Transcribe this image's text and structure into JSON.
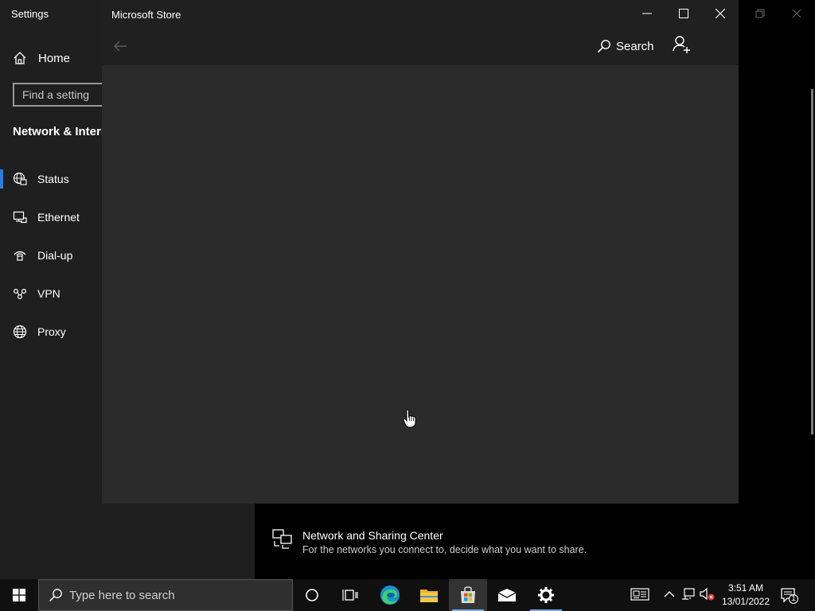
{
  "settings": {
    "title": "Settings",
    "home_label": "Home",
    "find_placeholder": "Find a setting",
    "section_title": "Network & Internet",
    "nav_items": [
      {
        "label": "Status",
        "icon": "globe-status-icon",
        "active": true
      },
      {
        "label": "Ethernet",
        "icon": "ethernet-icon",
        "active": false
      },
      {
        "label": "Dial-up",
        "icon": "dialup-icon",
        "active": false
      },
      {
        "label": "VPN",
        "icon": "vpn-icon",
        "active": false
      },
      {
        "label": "Proxy",
        "icon": "globe-icon",
        "active": false
      }
    ],
    "network_sharing": {
      "title": "Network and Sharing Center",
      "description": "For the networks you connect to, decide what you want to share."
    },
    "accent_color": "#2b7fd9"
  },
  "store": {
    "title": "Microsoft Store",
    "search_label": "Search"
  },
  "taskbar": {
    "search_placeholder": "Type here to search",
    "pinned": [
      "cortana-icon",
      "task-view-icon",
      "edge-icon",
      "file-explorer-icon",
      "store-icon",
      "mail-icon",
      "settings-icon"
    ],
    "active_app": "store-icon",
    "time": "3:51 AM",
    "date": "13/01/2022",
    "notification_count": "1"
  }
}
